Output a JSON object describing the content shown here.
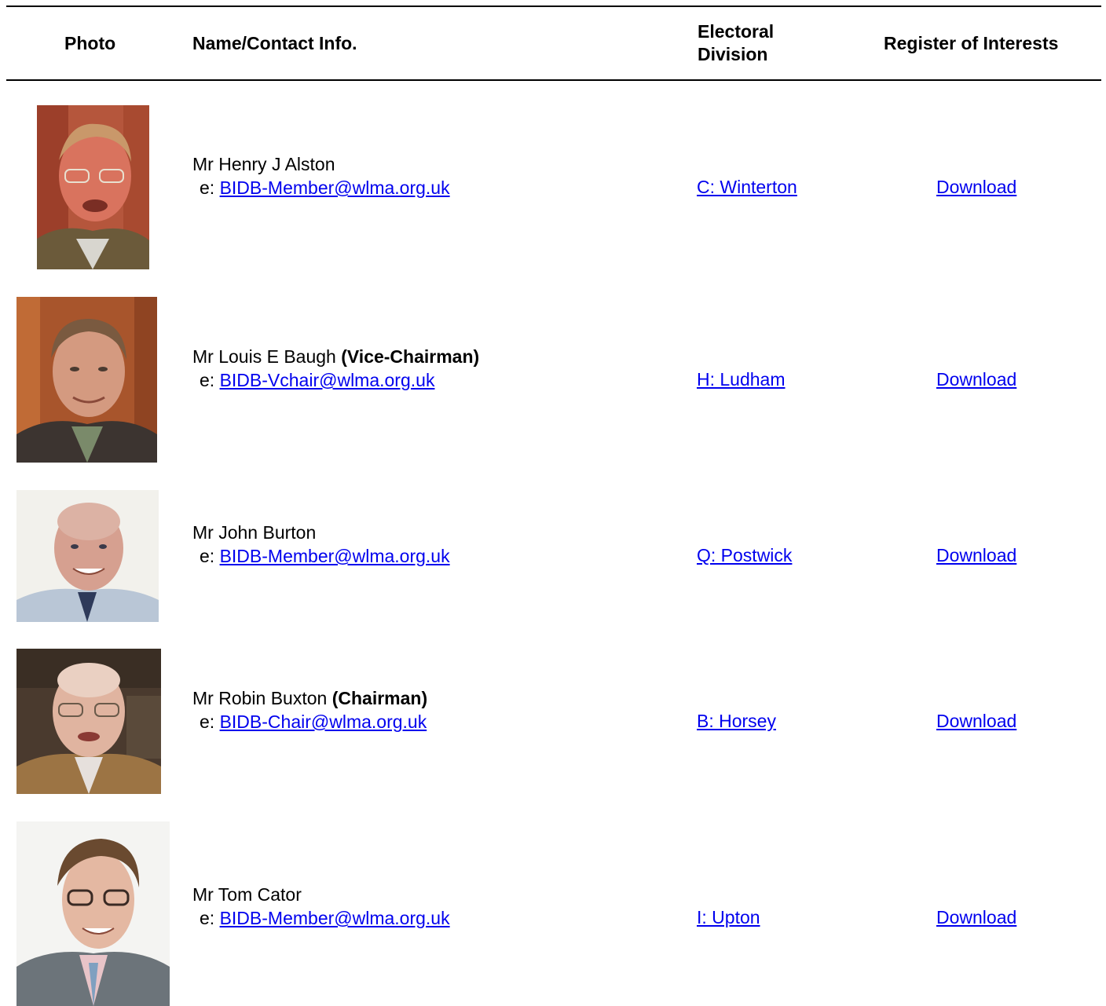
{
  "header": {
    "photo": "Photo",
    "name_contact": "Name/Contact Info.",
    "division_line1": "Electoral",
    "division_line2": "Division",
    "interests": "Register of Interests"
  },
  "members": [
    {
      "name": "Mr Henry J Alston",
      "role": "",
      "email_prefix": "e:",
      "email": "BIDB-Member@wlma.org.uk",
      "division": "C: Winterton",
      "interests_link": "Download"
    },
    {
      "name": "Mr Louis E Baugh",
      "role": "(Vice-Chairman)",
      "email_prefix": "e:",
      "email": "BIDB-Vchair@wlma.org.uk",
      "division": "H: Ludham",
      "interests_link": "Download"
    },
    {
      "name": "Mr John Burton",
      "role": "",
      "email_prefix": "e:",
      "email": "BIDB-Member@wlma.org.uk",
      "division": "Q: Postwick",
      "interests_link": "Download"
    },
    {
      "name": "Mr Robin Buxton",
      "role": "(Chairman)",
      "email_prefix": "e:",
      "email": "BIDB-Chair@wlma.org.uk",
      "division": "B: Horsey",
      "interests_link": "Download"
    },
    {
      "name": "Mr Tom Cator",
      "role": "",
      "email_prefix": "e:",
      "email": "BIDB-Member@wlma.org.uk",
      "division": "I: Upton",
      "interests_link": "Download"
    }
  ],
  "colors": {
    "link": "#0000ee",
    "text": "#000000",
    "rule": "#000000"
  }
}
